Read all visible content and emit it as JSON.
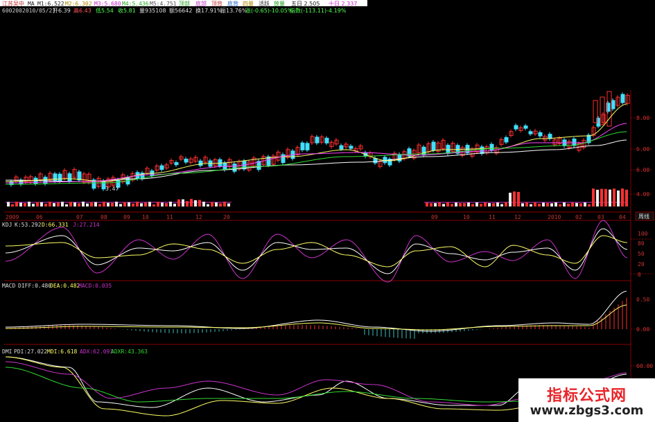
{
  "colors": {
    "bg": "#000000",
    "up": "#ff3030",
    "down": "#40e0ff",
    "ma1": "#ffffff",
    "ma2": "#ffff66",
    "ma3": "#ff44ff",
    "ma4": "#33dd33",
    "ma5": "#aaaaaa",
    "grid": "#7a0000",
    "axis": "#cc3333"
  },
  "header": {
    "name": "江苏吴中",
    "ma_line": [
      "MA",
      "M1:6.522",
      "M2:6.302",
      "M3:5.680",
      "M4:5.436",
      "M5:4.751"
    ],
    "tags": [
      "顶部",
      "底部",
      "顶背",
      "底背",
      "四量",
      "活跃",
      "放量"
    ],
    "five_day": "五日 2.505",
    "ten_day": "十日 2.337",
    "code": "600200",
    "date": "2010/05/21",
    "quote": [
      "开6.39",
      "高6.43",
      "低5.54",
      "收5.81",
      "量935108",
      "额56642",
      "换17.91%",
      "振13.76%",
      "涨(-0.65)-10.05%",
      "指数(-113.11)-4.19%"
    ]
  },
  "price_axis": [
    "8.00",
    "6.00",
    "6.00",
    "4.00"
  ],
  "kdj_axis": [
    "100",
    "80",
    "50",
    "20",
    "0"
  ],
  "macd_axis": [
    "0.50",
    "0.00"
  ],
  "dmi_axis": [
    "60.00"
  ],
  "time_axis_left": [
    "2009",
    "06",
    "07",
    "08",
    "09",
    "10",
    "11",
    "12",
    "20"
  ],
  "time_axis_right": [
    "09",
    "10",
    "11",
    "12",
    "2010",
    "02",
    "03",
    "04"
  ],
  "low_label": "3.47",
  "indicators": {
    "kdj": {
      "label": "KDJ",
      "k": "K:53.292",
      "d": "D:66.331",
      "j": "J:27.214"
    },
    "macd": {
      "label": "MACD",
      "diff": "DIFF:0.480",
      "dea": "DEA:0.482",
      "macd": "MACD:0.035"
    },
    "dmi": {
      "label": "DMI",
      "pdi": "PDI:27.022",
      "mdi": "MDI:6.618",
      "adx": "ADX:62.093",
      "adxr": "ADXR:43.363"
    }
  },
  "tab_label": "周线",
  "watermark": {
    "title": "指标公式网",
    "url": "www.zbgs3.com"
  }
}
